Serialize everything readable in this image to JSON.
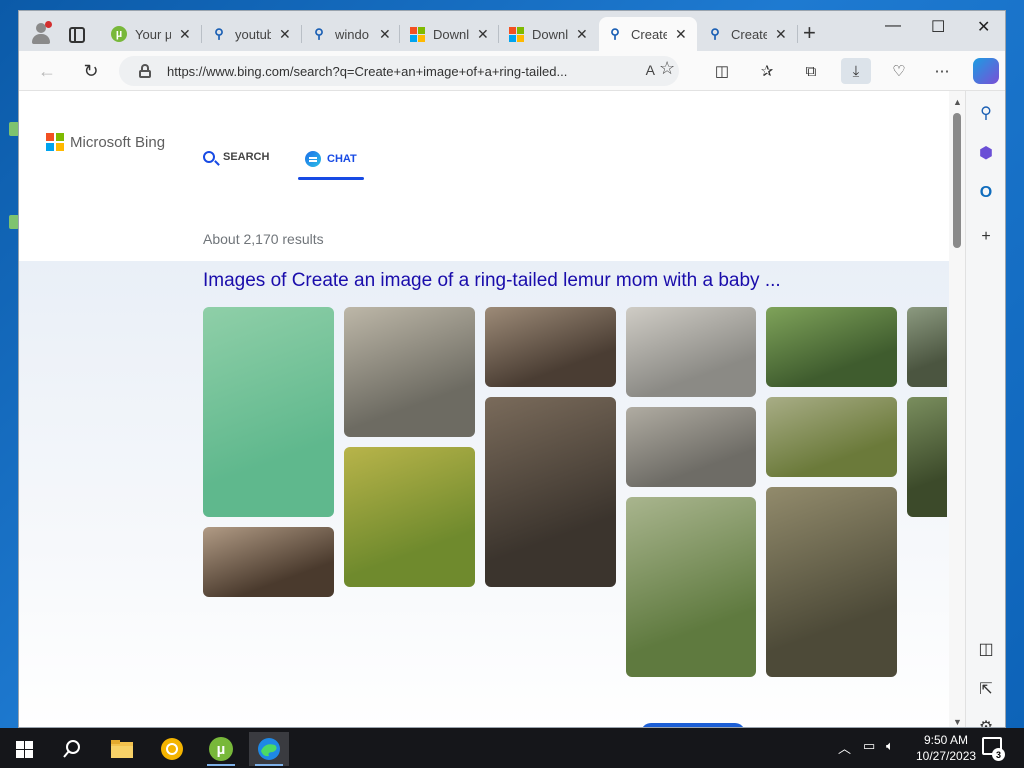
{
  "browser": {
    "tabs": [
      {
        "title": "Your µ",
        "icon": "utorrent-icon"
      },
      {
        "title": "youtub",
        "icon": "bing-search-icon"
      },
      {
        "title": "windo",
        "icon": "bing-search-icon"
      },
      {
        "title": "Downl",
        "icon": "microsoft-icon"
      },
      {
        "title": "Downl",
        "icon": "microsoft-icon"
      },
      {
        "title": "Create",
        "icon": "bing-search-icon",
        "active": true
      },
      {
        "title": "Create",
        "icon": "bing-search-icon"
      }
    ],
    "url": "https://www.bing.com/search?q=Create+an+image+of+a+ring-tailed...",
    "read_aloud_glyph": "A"
  },
  "bing": {
    "logo_text": "Microsoft Bing",
    "scopes": {
      "search": "SEARCH",
      "chat": "CHAT"
    },
    "results_count": "About 2,170 results",
    "images_heading": "Images of Create an image of a ring-tailed lemur mom with a baby ..."
  },
  "thumbnails": [
    {
      "subject": "lemur on branch, painted style",
      "colors": [
        "#5fb88d",
        "#8fcfa8"
      ]
    },
    {
      "subject": "lemur with tail on log",
      "colors": [
        "#6d6b62",
        "#bdb7a8"
      ]
    },
    {
      "subject": "two lemurs close up",
      "colors": [
        "#4a3d33",
        "#9d8b78"
      ]
    },
    {
      "subject": "lemur mom and baby faces",
      "colors": [
        "#8b8a85",
        "#cfccc5"
      ]
    },
    {
      "subject": "lemur on stump in forest",
      "colors": [
        "#3f5c2e",
        "#7fa35a"
      ]
    },
    {
      "subject": "lemur partially visible",
      "colors": [
        "#4b5540",
        "#8c9a80"
      ]
    },
    {
      "subject": "two lemurs walking with tails up",
      "colors": [
        "#6f8a2d",
        "#b8b44a"
      ]
    },
    {
      "subject": "lemur with baby on rock",
      "colors": [
        "#3b342d",
        "#7a6b5b"
      ]
    },
    {
      "subject": "lemur lying down",
      "colors": [
        "#6e6c66",
        "#b0aca2"
      ]
    },
    {
      "subject": "lemur with baby on back",
      "colors": [
        "#6b7a3a",
        "#a8ad86"
      ]
    },
    {
      "subject": "lemur partially visible 2",
      "colors": [
        "#3c4a2a",
        "#7a8e5e"
      ]
    },
    {
      "subject": "two lemurs cuddling",
      "colors": [
        "#4a3a2d",
        "#b19b85"
      ]
    },
    {
      "subject": "lemur sitting with tail curled",
      "colors": [
        "#5f7a3f",
        "#a9b58e"
      ]
    },
    {
      "subject": "lemur mom hugging baby",
      "colors": [
        "#4d4a38",
        "#928b6c"
      ]
    }
  ],
  "taskbar": {
    "time": "9:50 AM",
    "date": "10/27/2023",
    "notification_count": "3"
  }
}
